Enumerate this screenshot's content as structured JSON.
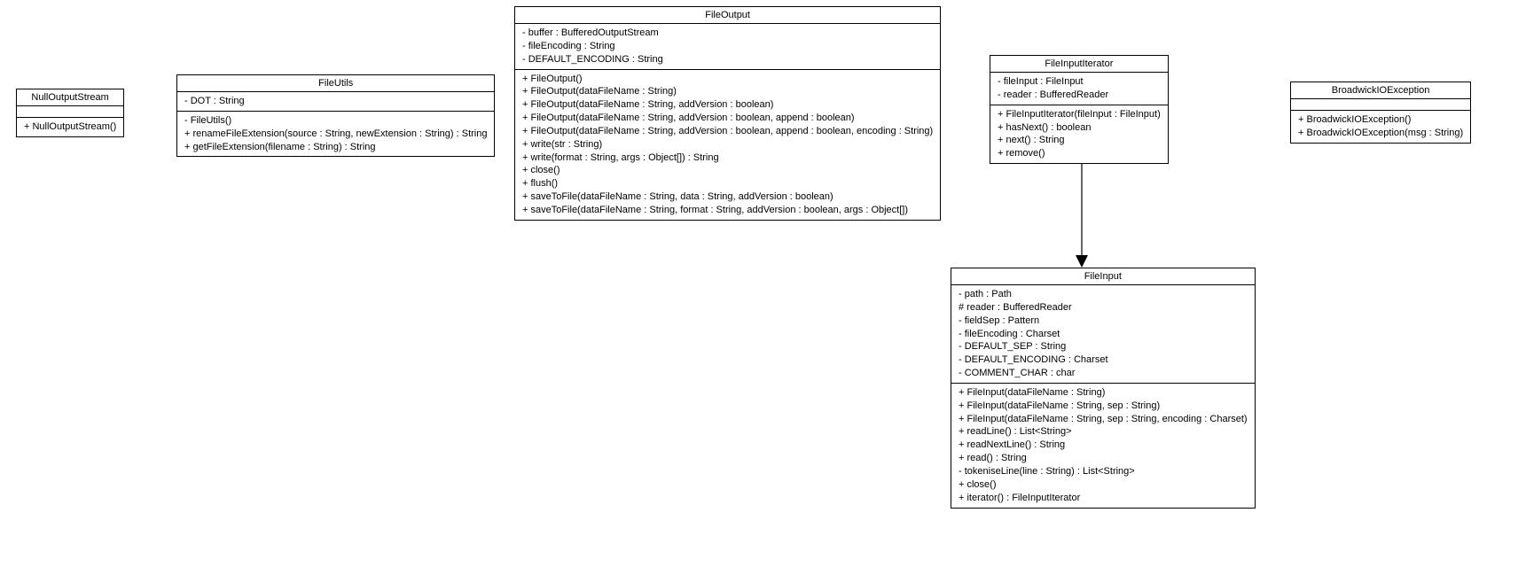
{
  "chart_data": {
    "type": "uml-class-diagram",
    "classes": [
      {
        "id": "NullOutputStream",
        "name": "NullOutputStream",
        "attributes": [],
        "methods": [
          "+ NullOutputStream()"
        ]
      },
      {
        "id": "FileUtils",
        "name": "FileUtils",
        "attributes": [
          "- DOT : String"
        ],
        "methods": [
          "- FileUtils()",
          "+ renameFileExtension(source : String, newExtension : String) : String",
          "+ getFileExtension(filename : String) : String"
        ]
      },
      {
        "id": "FileOutput",
        "name": "FileOutput",
        "attributes": [
          "- buffer : BufferedOutputStream",
          "- fileEncoding : String",
          "- DEFAULT_ENCODING : String"
        ],
        "methods": [
          "+ FileOutput()",
          "+ FileOutput(dataFileName : String)",
          "+ FileOutput(dataFileName : String, addVersion : boolean)",
          "+ FileOutput(dataFileName : String, addVersion : boolean, append : boolean)",
          "+ FileOutput(dataFileName : String, addVersion : boolean, append : boolean, encoding : String)",
          "+ write(str : String)",
          "+ write(format : String, args : Object[]) : String",
          "+ close()",
          "+ flush()",
          "+ saveToFile(dataFileName : String, data : String, addVersion : boolean)",
          "+ saveToFile(dataFileName : String, format : String, addVersion : boolean, args : Object[])"
        ]
      },
      {
        "id": "FileInputIterator",
        "name": "FileInputIterator",
        "attributes": [
          "- fileInput : FileInput",
          "- reader : BufferedReader"
        ],
        "methods": [
          "+ FileInputIterator(fileInput : FileInput)",
          "+ hasNext() : boolean",
          "+ next() : String",
          "+ remove()"
        ]
      },
      {
        "id": "BroadwickIOException",
        "name": "BroadwickIOException",
        "attributes": [],
        "methods": [
          "+ BroadwickIOException()",
          "+ BroadwickIOException(msg : String)"
        ]
      },
      {
        "id": "FileInput",
        "name": "FileInput",
        "attributes": [
          "- path : Path",
          "# reader : BufferedReader",
          "- fieldSep : Pattern",
          "- fileEncoding : Charset",
          "- DEFAULT_SEP : String",
          "- DEFAULT_ENCODING : Charset",
          "- COMMENT_CHAR : char"
        ],
        "methods": [
          "+ FileInput(dataFileName : String)",
          "+ FileInput(dataFileName : String, sep : String)",
          "+ FileInput(dataFileName : String, sep : String, encoding : Charset)",
          "+ readLine() : List<String>",
          "+ readNextLine() : String",
          "+ read() : String",
          "- tokeniseLine(line : String) : List<String>",
          "+ close()",
          "+ iterator() : FileInputIterator"
        ]
      }
    ],
    "relations": [
      {
        "from": "FileInputIterator",
        "to": "FileInput",
        "type": "association-directed"
      }
    ]
  },
  "classes": {
    "NullOutputStream": {
      "name": "NullOutputStream",
      "methods": {
        "m0": "+ NullOutputStream()"
      }
    },
    "FileUtils": {
      "name": "FileUtils",
      "attrs": {
        "a0": "- DOT : String"
      },
      "methods": {
        "m0": "- FileUtils()",
        "m1": "+ renameFileExtension(source : String, newExtension : String) : String",
        "m2": "+ getFileExtension(filename : String) : String"
      }
    },
    "FileOutput": {
      "name": "FileOutput",
      "attrs": {
        "a0": "- buffer : BufferedOutputStream",
        "a1": "- fileEncoding : String",
        "a2": "- DEFAULT_ENCODING : String"
      },
      "methods": {
        "m0": "+ FileOutput()",
        "m1": "+ FileOutput(dataFileName : String)",
        "m2": "+ FileOutput(dataFileName : String, addVersion : boolean)",
        "m3": "+ FileOutput(dataFileName : String, addVersion : boolean, append : boolean)",
        "m4": "+ FileOutput(dataFileName : String, addVersion : boolean, append : boolean, encoding : String)",
        "m5": "+ write(str : String)",
        "m6": "+ write(format : String, args : Object[]) : String",
        "m7": "+ close()",
        "m8": "+ flush()",
        "m9": "+ saveToFile(dataFileName : String, data : String, addVersion : boolean)",
        "m10": "+ saveToFile(dataFileName : String, format : String, addVersion : boolean, args : Object[])"
      }
    },
    "FileInputIterator": {
      "name": "FileInputIterator",
      "attrs": {
        "a0": "- fileInput : FileInput",
        "a1": "- reader : BufferedReader"
      },
      "methods": {
        "m0": "+ FileInputIterator(fileInput : FileInput)",
        "m1": "+ hasNext() : boolean",
        "m2": "+ next() : String",
        "m3": "+ remove()"
      }
    },
    "BroadwickIOException": {
      "name": "BroadwickIOException",
      "methods": {
        "m0": "+ BroadwickIOException()",
        "m1": "+ BroadwickIOException(msg : String)"
      }
    },
    "FileInput": {
      "name": "FileInput",
      "attrs": {
        "a0": "- path : Path",
        "a1": "# reader : BufferedReader",
        "a2": "- fieldSep : Pattern",
        "a3": "- fileEncoding : Charset",
        "a4": "- DEFAULT_SEP : String",
        "a5": "- DEFAULT_ENCODING : Charset",
        "a6": "- COMMENT_CHAR : char"
      },
      "methods": {
        "m0": "+ FileInput(dataFileName : String)",
        "m1": "+ FileInput(dataFileName : String, sep : String)",
        "m2": "+ FileInput(dataFileName : String, sep : String, encoding : Charset)",
        "m3": "+ readLine() : List<String>",
        "m4": "+ readNextLine() : String",
        "m5": "+ read() : String",
        "m6": "- tokeniseLine(line : String) : List<String>",
        "m7": "+ close()",
        "m8": "+ iterator() : FileInputIterator"
      }
    }
  }
}
